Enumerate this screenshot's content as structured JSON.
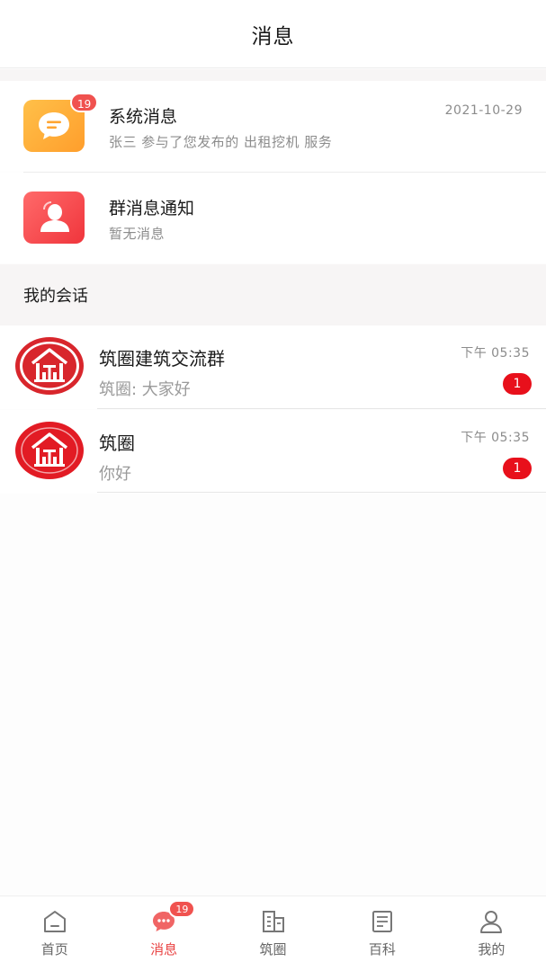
{
  "header": {
    "title": "消息"
  },
  "notices": [
    {
      "title": "系统消息",
      "subtitle": "张三 参与了您发布的 出租挖机 服务",
      "date": "2021-10-29",
      "badge": "19",
      "icon": "chat-bubble-icon",
      "color": "#ffa531"
    },
    {
      "title": "群消息通知",
      "subtitle": "暂无消息",
      "date": "",
      "badge": "",
      "icon": "group-person-icon",
      "color": "#f0353c"
    }
  ],
  "section": {
    "title": "我的会话"
  },
  "conversations": [
    {
      "name": "筑圈建筑交流群",
      "last_message": "筑圈: 大家好",
      "time": "下午 05:35",
      "unread": "1",
      "avatar_style": "outlined"
    },
    {
      "name": "筑圈",
      "last_message": "你好",
      "time": "下午 05:35",
      "unread": "1",
      "avatar_style": "solid"
    }
  ],
  "tabbar": {
    "items": [
      {
        "label": "首页",
        "icon": "home-icon",
        "active": false
      },
      {
        "label": "消息",
        "icon": "message-icon",
        "active": true,
        "badge": "19"
      },
      {
        "label": "筑圈",
        "icon": "buildings-icon",
        "active": false
      },
      {
        "label": "百科",
        "icon": "encyclopedia-icon",
        "active": false
      },
      {
        "label": "我的",
        "icon": "profile-icon",
        "active": false
      }
    ]
  },
  "colors": {
    "accent": "#e94343",
    "unread": "#e8101b",
    "brand_red": "#d8262c"
  }
}
